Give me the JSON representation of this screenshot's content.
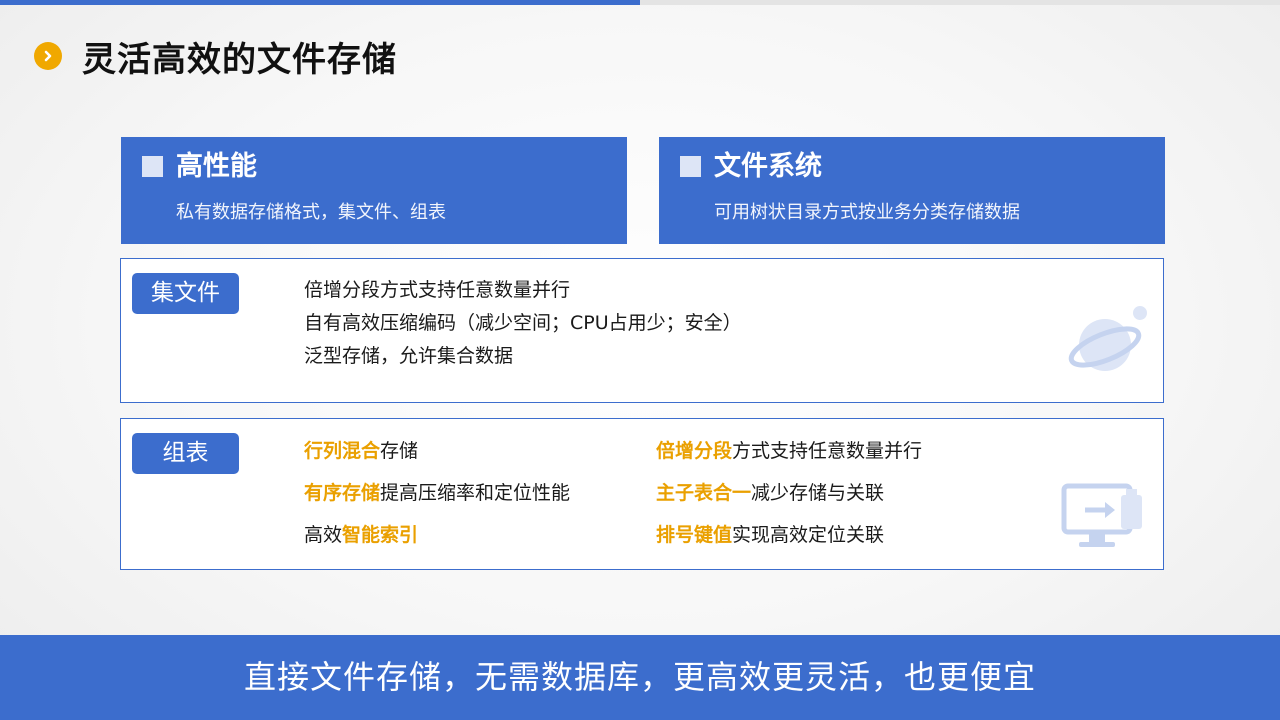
{
  "header": {
    "title": "灵活高效的文件存储",
    "icon": "chevron-right-icon"
  },
  "cards": [
    {
      "title": "高性能",
      "desc": "私有数据存储格式，集文件、组表"
    },
    {
      "title": "文件系统",
      "desc": "可用树状目录方式按业务分类存储数据"
    }
  ],
  "jiwenjian": {
    "tag": "集文件",
    "lines": [
      "倍增分段方式支持任意数量并行",
      "自有高效压缩编码（减少空间；CPU占用少；安全）",
      "泛型存储，允许集合数据"
    ]
  },
  "zubiao": {
    "tag": "组表",
    "left": [
      {
        "hl": "行列混合",
        "rest": "存储"
      },
      {
        "hl": "有序存储",
        "rest": "提高压缩率和定位性能"
      },
      {
        "pre": "高效",
        "hl": "智能索引"
      }
    ],
    "right": [
      {
        "hl": "倍增分段",
        "rest": "方式支持任意数量并行"
      },
      {
        "hl": "主子表合一",
        "rest": "减少存储与关联"
      },
      {
        "hl": "排号键值",
        "rest": "实现高效定位关联"
      }
    ]
  },
  "footer": {
    "text": "直接文件存储，无需数据库，更高效更灵活，也更便宜"
  },
  "colors": {
    "accent_blue": "#3c6dcd",
    "highlight_orange": "#eaa000",
    "title_icon": "#f0a800"
  }
}
